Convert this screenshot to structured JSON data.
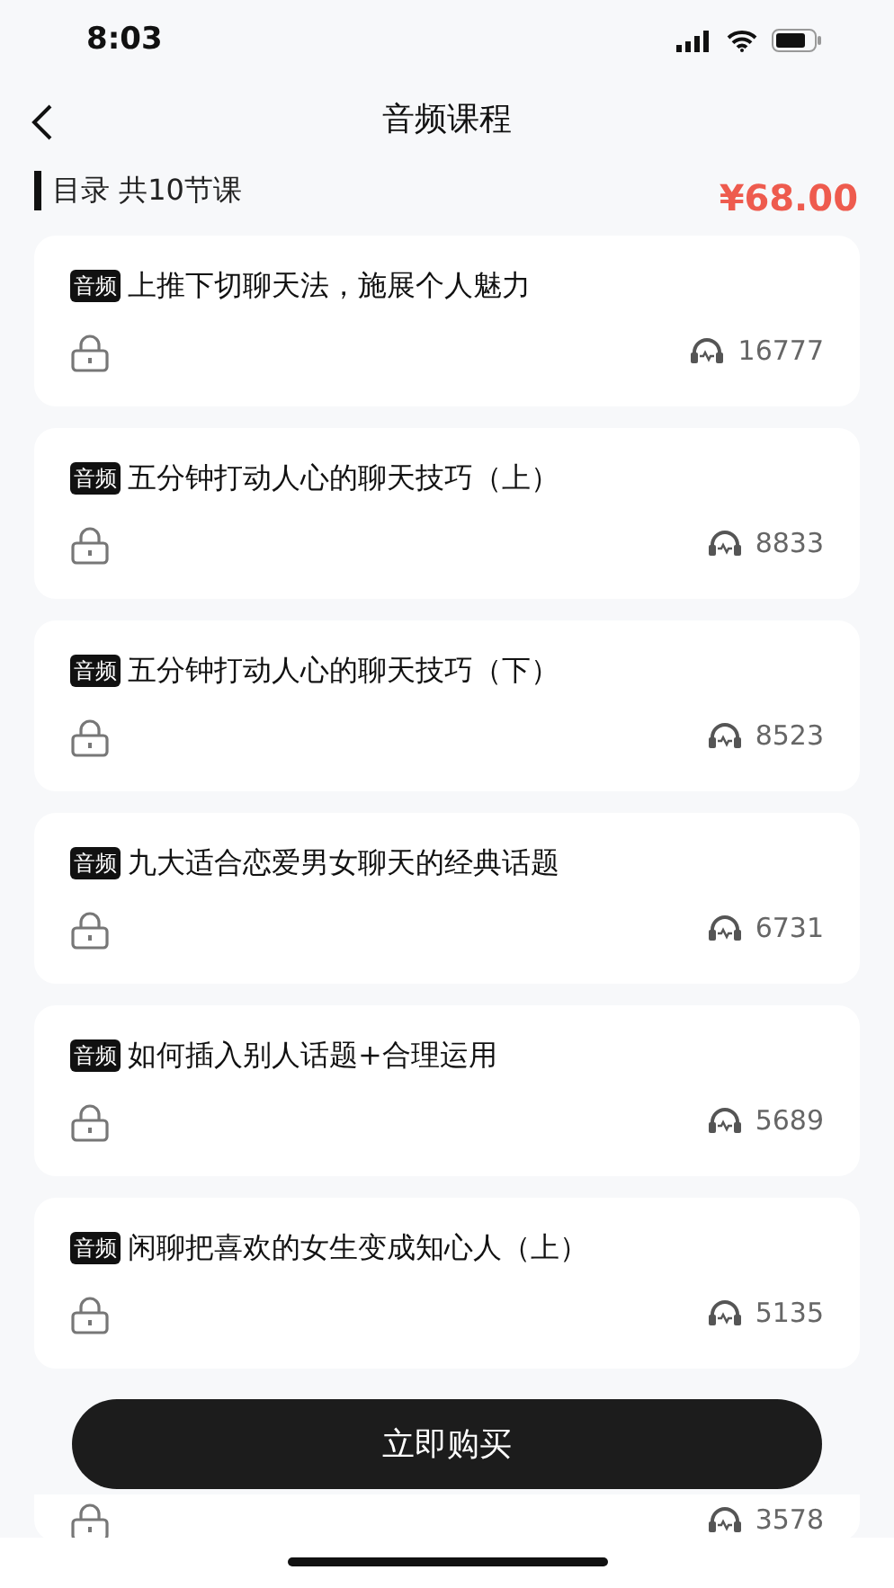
{
  "status_bar": {
    "time": "8:03"
  },
  "nav": {
    "title": "音频课程"
  },
  "header": {
    "label": "目录 共10节课",
    "price": "¥68.00"
  },
  "lessons": [
    {
      "tag": "音频",
      "title": "上推下切聊天法，施展个人魅力",
      "locked": true,
      "plays": "16777"
    },
    {
      "tag": "音频",
      "title": "五分钟打动人心的聊天技巧（上）",
      "locked": true,
      "plays": "8833"
    },
    {
      "tag": "音频",
      "title": "五分钟打动人心的聊天技巧（下）",
      "locked": true,
      "plays": "8523"
    },
    {
      "tag": "音频",
      "title": "九大适合恋爱男女聊天的经典话题",
      "locked": true,
      "plays": "6731"
    },
    {
      "tag": "音频",
      "title": "如何插入别人话题+合理运用",
      "locked": true,
      "plays": "5689"
    },
    {
      "tag": "音频",
      "title": "闲聊把喜欢的女生变成知心人（上）",
      "locked": true,
      "plays": "5135"
    },
    {
      "locked": true,
      "plays": "3578"
    }
  ],
  "buy_button": "立即购买"
}
